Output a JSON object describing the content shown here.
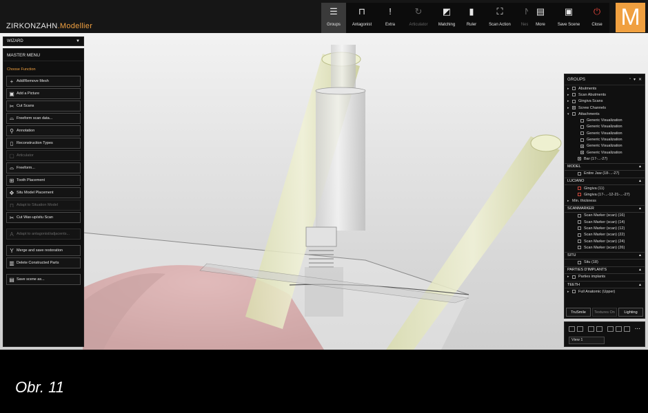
{
  "app": {
    "brand_main": "ZIRKONZAHN",
    "brand_sub": ".Modellier",
    "logo_letter": "M",
    "accent": "#f0a040"
  },
  "toolbar": {
    "main": [
      {
        "name": "groups",
        "label": "Groups",
        "icon": "☰",
        "state": "active"
      },
      {
        "name": "antagonist",
        "label": "Antagonist",
        "icon": "⊓",
        "state": "normal"
      },
      {
        "name": "extra",
        "label": "Extra",
        "icon": "!",
        "state": "normal"
      },
      {
        "name": "articulator",
        "label": "Articulator",
        "icon": "↻",
        "state": "disabled"
      },
      {
        "name": "matching",
        "label": "Matching",
        "icon": "◩",
        "state": "normal"
      },
      {
        "name": "ruler",
        "label": "Ruler",
        "icon": "▮",
        "state": "normal"
      },
      {
        "name": "scan-action",
        "label": "Scan Action",
        "icon": "⛶",
        "state": "normal"
      },
      {
        "name": "nesting",
        "label": "Nesting",
        "icon": "N",
        "state": "disabled"
      }
    ],
    "secondary": [
      {
        "name": "more",
        "label": "More",
        "icon": "▤",
        "state": "normal"
      },
      {
        "name": "save-scene",
        "label": "Save Scene",
        "icon": "▣",
        "state": "normal"
      },
      {
        "name": "close",
        "label": "Close",
        "icon": "⏻",
        "state": "normal",
        "red": true
      }
    ]
  },
  "wizard": {
    "selected": "WIZARD"
  },
  "left_panel": {
    "title": "MASTER MENU",
    "section": "Choose Function",
    "buttons": [
      {
        "label": "Add/Remove Mesh",
        "icon": "+",
        "disabled": false
      },
      {
        "label": "Add a Picture",
        "icon": "▣",
        "disabled": false
      },
      {
        "label": "Cut Scans",
        "icon": "✂",
        "disabled": false
      },
      {
        "label": "Freeform scan data...",
        "icon": "⌓",
        "disabled": false
      },
      {
        "label": "Annotation",
        "icon": "⚲",
        "disabled": false
      },
      {
        "label": "Reconstruction Types",
        "icon": "▯",
        "disabled": false
      },
      {
        "label": "Articulator",
        "icon": "▢",
        "disabled": true
      },
      {
        "label": "Freeform...",
        "icon": "⌓",
        "disabled": false
      },
      {
        "label": "Tooth Placement",
        "icon": "⊞",
        "disabled": false
      },
      {
        "label": "Situ Model Placement",
        "icon": "✥",
        "disabled": false
      },
      {
        "label": "Adapt to Situation Model",
        "icon": "⊓",
        "disabled": true
      },
      {
        "label": "Cut Wax-up/situ Scan",
        "icon": "✂",
        "disabled": false
      },
      {
        "label": "Adapt to antagonist/adjacents...",
        "icon": "A",
        "disabled": true,
        "sep_before": true
      },
      {
        "label": "Merge and save restoration",
        "icon": "Y",
        "disabled": false,
        "sep_before": true
      },
      {
        "label": "Delete Constructed Parts",
        "icon": "▥",
        "disabled": false
      },
      {
        "label": "Save scene as...",
        "icon": "▤",
        "disabled": false,
        "sep_before": true
      }
    ]
  },
  "groups_panel": {
    "title": "GROUPS",
    "tree": [
      {
        "label": "Abutments",
        "arrow": "▸",
        "level": 1,
        "cb": "off"
      },
      {
        "label": "Scan Abutments",
        "arrow": "▸",
        "level": 1,
        "cb": "off"
      },
      {
        "label": "Gingiva Scans",
        "arrow": "▸",
        "level": 1,
        "cb": "off"
      },
      {
        "label": "Screw Channels",
        "arrow": "▸",
        "level": 1,
        "cb": "on"
      },
      {
        "label": "Attachments",
        "arrow": "▾",
        "level": 1,
        "cb": "off"
      },
      {
        "label": "Generic Visualization",
        "arrow": "",
        "level": 3,
        "cb": "off"
      },
      {
        "label": "Generic Visualization",
        "arrow": "",
        "level": 3,
        "cb": "off"
      },
      {
        "label": "Generic Visualization",
        "arrow": "",
        "level": 3,
        "cb": "off"
      },
      {
        "label": "Generic Visualization",
        "arrow": "",
        "level": 3,
        "cb": "off"
      },
      {
        "label": "Generic Visualization",
        "arrow": "",
        "level": 3,
        "cb": "on"
      },
      {
        "label": "Generic Visualization",
        "arrow": "",
        "level": 3,
        "cb": "on"
      },
      {
        "label": "Bar (17-...-27)",
        "arrow": "",
        "level": 2,
        "cb": "on"
      }
    ],
    "sections": [
      {
        "title": "MODEL",
        "rows": [
          {
            "label": "Entire Jaw (18-...-27)",
            "arrow": "",
            "level": 2,
            "cb": "off"
          }
        ]
      },
      {
        "title": "LUCIANO",
        "rows": [
          {
            "label": "Gingiva (11)",
            "arrow": "",
            "level": 2,
            "cb": "red"
          },
          {
            "label": "Gingiva (17-...-12-21-...-27)",
            "arrow": "",
            "level": 2,
            "cb": "red"
          },
          {
            "label": "Min. thickness",
            "arrow": "▸",
            "level": 1,
            "cb": "none"
          }
        ]
      },
      {
        "title": "SCANMARKER",
        "rows": [
          {
            "label": "Scan Marker (scan) (16)",
            "arrow": "",
            "level": 2,
            "cb": "off"
          },
          {
            "label": "Scan Marker (scan) (14)",
            "arrow": "",
            "level": 2,
            "cb": "off"
          },
          {
            "label": "Scan Marker (scan) (12)",
            "arrow": "",
            "level": 2,
            "cb": "off"
          },
          {
            "label": "Scan Marker (scan) (22)",
            "arrow": "",
            "level": 2,
            "cb": "off"
          },
          {
            "label": "Scan Marker (scan) (24)",
            "arrow": "",
            "level": 2,
            "cb": "off"
          },
          {
            "label": "Scan Marker (scan) (26)",
            "arrow": "",
            "level": 2,
            "cb": "off"
          }
        ]
      },
      {
        "title": "SITU",
        "rows": [
          {
            "label": "Situ (18)",
            "arrow": "",
            "level": 2,
            "cb": "off"
          }
        ]
      },
      {
        "title": "PARTIES D'IMPLANTS",
        "rows": [
          {
            "label": "Parties implants",
            "arrow": "▸",
            "level": 1,
            "cb": "off"
          }
        ]
      },
      {
        "title": "TEETH",
        "rows": [
          {
            "label": "Full Anatomic (Upper)",
            "arrow": "▸",
            "level": 1,
            "cb": "off"
          }
        ]
      }
    ],
    "footer": {
      "trusmile": "TruSmile",
      "textures": "Textures On",
      "lighting": "Lighting"
    }
  },
  "view_panel": {
    "view_name": "View 1",
    "more": "..."
  },
  "caption": "Obr. 11"
}
